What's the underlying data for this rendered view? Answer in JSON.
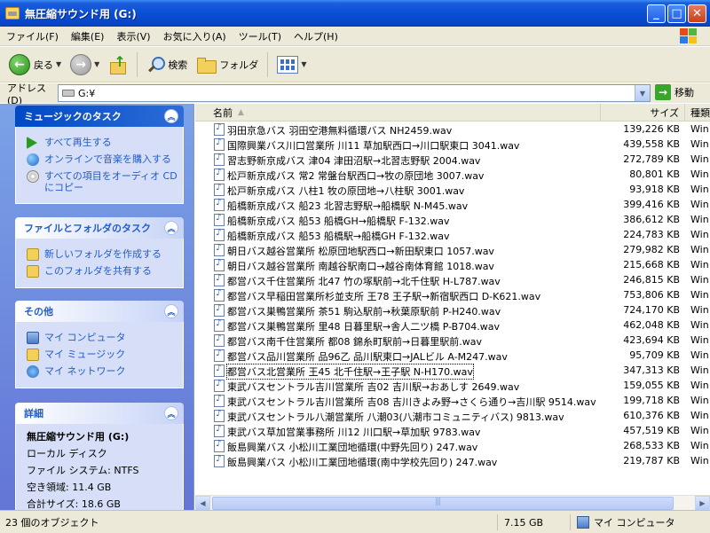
{
  "window": {
    "title": "無圧縮サウンド用 (G:)",
    "minimize": "_",
    "maximize": "□",
    "close": "✕"
  },
  "menu": [
    "ファイル(F)",
    "編集(E)",
    "表示(V)",
    "お気に入り(A)",
    "ツール(T)",
    "ヘルプ(H)"
  ],
  "toolbar": {
    "back": "戻る",
    "search": "検索",
    "folders": "フォルダ"
  },
  "address": {
    "label": "アドレス(D)",
    "value": "G:¥",
    "go": "移動"
  },
  "left_pane": {
    "music_tasks": {
      "title": "ミュージックのタスク",
      "items": [
        "すべて再生する",
        "オンラインで音楽を購入する",
        "すべての項目をオーディオ CD にコピー"
      ]
    },
    "file_tasks": {
      "title": "ファイルとフォルダのタスク",
      "items": [
        "新しいフォルダを作成する",
        "このフォルダを共有する"
      ]
    },
    "other": {
      "title": "その他",
      "items": [
        "マイ コンピュータ",
        "マイ ミュージック",
        "マイ ネットワーク"
      ]
    },
    "details": {
      "title": "詳細",
      "name": "無圧縮サウンド用 (G:)",
      "kind": "ローカル ディスク",
      "fs": "ファイル システム: NTFS",
      "free": "空き領域: 11.4 GB",
      "total": "合計サイズ: 18.6 GB"
    }
  },
  "list": {
    "headers": {
      "name": "名前",
      "size": "サイズ",
      "type": "種類"
    },
    "rows": [
      {
        "name": "羽田京急バス 羽田空港無料循環バス NH2459.wav",
        "size": "139,226 KB",
        "type": "Win"
      },
      {
        "name": "国際興業バス川口営業所 川11 草加駅西口→川口駅東口 3041.wav",
        "size": "439,558 KB",
        "type": "Win"
      },
      {
        "name": "習志野新京成バス 津04 津田沼駅→北習志野駅 2004.wav",
        "size": "272,789 KB",
        "type": "Win"
      },
      {
        "name": "松戸新京成バス 常2 常盤台駅西口→牧の原団地 3007.wav",
        "size": "80,801 KB",
        "type": "Win"
      },
      {
        "name": "松戸新京成バス 八柱1 牧の原団地→八柱駅 3001.wav",
        "size": "93,918 KB",
        "type": "Win"
      },
      {
        "name": "船橋新京成バス 船23 北習志野駅→船橋駅 N-M45.wav",
        "size": "399,416 KB",
        "type": "Win"
      },
      {
        "name": "船橋新京成バス 船53 船橋GH→船橋駅 F-132.wav",
        "size": "386,612 KB",
        "type": "Win"
      },
      {
        "name": "船橋新京成バス 船53 船橋駅→船橋GH F-132.wav",
        "size": "224,783 KB",
        "type": "Win"
      },
      {
        "name": "朝日バス越谷営業所 松原団地駅西口→新田駅東口 1057.wav",
        "size": "279,982 KB",
        "type": "Win"
      },
      {
        "name": "朝日バス越谷営業所 南越谷駅南口→越谷南体育館 1018.wav",
        "size": "215,668 KB",
        "type": "Win"
      },
      {
        "name": "都営バス千住営業所 北47 竹の塚駅前→北千住駅 H-L787.wav",
        "size": "246,815 KB",
        "type": "Win"
      },
      {
        "name": "都営バス早稲田営業所杉並支所 王78 王子駅→新宿駅西口 D-K621.wav",
        "size": "753,806 KB",
        "type": "Win"
      },
      {
        "name": "都営バス巣鴨営業所 茶51 駒込駅前→秋葉原駅前 P-H240.wav",
        "size": "724,170 KB",
        "type": "Win"
      },
      {
        "name": "都営バス巣鴨営業所 里48 日暮里駅→舎人二ツ橋 P-B704.wav",
        "size": "462,048 KB",
        "type": "Win"
      },
      {
        "name": "都営バス南千住営業所 都08 錦糸町駅前→日暮里駅前.wav",
        "size": "423,694 KB",
        "type": "Win"
      },
      {
        "name": "都営バス品川営業所 品96乙 品川駅東口→JALビル A-M247.wav",
        "size": "95,709 KB",
        "type": "Win"
      },
      {
        "name": "都営バス北営業所 王45 北千住駅→王子駅 N-H170.wav",
        "size": "347,313 KB",
        "type": "Win"
      },
      {
        "name": "東武バスセントラル吉川営業所 吉02 吉川駅→おあしす 2649.wav",
        "size": "159,055 KB",
        "type": "Win"
      },
      {
        "name": "東武バスセントラル吉川営業所 吉08 吉川きよみ野→さくら通り→吉川駅 9514.wav",
        "size": "199,718 KB",
        "type": "Win"
      },
      {
        "name": "東武バスセントラル八潮営業所 八潮03(八潮市コミュニティバス) 9813.wav",
        "size": "610,376 KB",
        "type": "Win"
      },
      {
        "name": "東武バス草加営業事務所 川12 川口駅→草加駅 9783.wav",
        "size": "457,519 KB",
        "type": "Win"
      },
      {
        "name": "飯島興業バス 小松川工業団地循環(中野先回り) 247.wav",
        "size": "268,533 KB",
        "type": "Win"
      },
      {
        "name": "飯島興業バス 小松川工業団地循環(南中学校先回り) 247.wav",
        "size": "219,787 KB",
        "type": "Win"
      }
    ]
  },
  "status": {
    "objects": "23 個のオブジェクト",
    "size": "7.15 GB",
    "location": "マイ コンピュータ"
  }
}
